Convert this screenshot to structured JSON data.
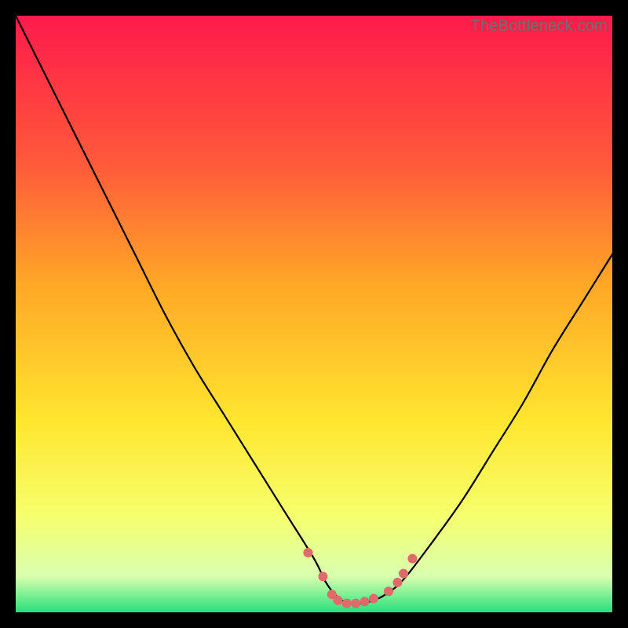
{
  "watermark": "TheBottleneck.com",
  "colors": {
    "gradient_top": "#ff1a4b",
    "gradient_mid1": "#ff5a3a",
    "gradient_mid2": "#ffa726",
    "gradient_mid3": "#ffe62e",
    "gradient_mid4": "#f6ff6e",
    "gradient_mid5": "#d8ffb0",
    "gradient_bottom": "#26e07a",
    "curve": "#000000",
    "marker": "#e06a6a",
    "frame": "#000000"
  },
  "chart_data": {
    "type": "line",
    "title": "",
    "xlabel": "",
    "ylabel": "",
    "xlim": [
      0,
      100
    ],
    "ylim": [
      0,
      100
    ],
    "grid": false,
    "legend": false,
    "series": [
      {
        "name": "bottleneck-curve",
        "x": [
          0,
          5,
          10,
          15,
          20,
          25,
          30,
          35,
          40,
          45,
          50,
          52,
          54,
          56,
          58,
          60,
          62,
          65,
          70,
          75,
          80,
          85,
          90,
          95,
          100
        ],
        "y": [
          100,
          90,
          80,
          70,
          60,
          50,
          41,
          33,
          25,
          17,
          9,
          5,
          2.5,
          1.5,
          1.5,
          2,
          3,
          5.5,
          12,
          19,
          27,
          35,
          44,
          52,
          60
        ]
      }
    ],
    "markers": [
      {
        "x": 49,
        "y": 10
      },
      {
        "x": 51.5,
        "y": 6
      },
      {
        "x": 53,
        "y": 3
      },
      {
        "x": 54,
        "y": 2
      },
      {
        "x": 55.5,
        "y": 1.5
      },
      {
        "x": 57,
        "y": 1.5
      },
      {
        "x": 58.5,
        "y": 1.8
      },
      {
        "x": 60,
        "y": 2.3
      },
      {
        "x": 62.5,
        "y": 3.5
      },
      {
        "x": 64,
        "y": 5
      },
      {
        "x": 65,
        "y": 6.5
      },
      {
        "x": 66.5,
        "y": 9
      }
    ]
  }
}
